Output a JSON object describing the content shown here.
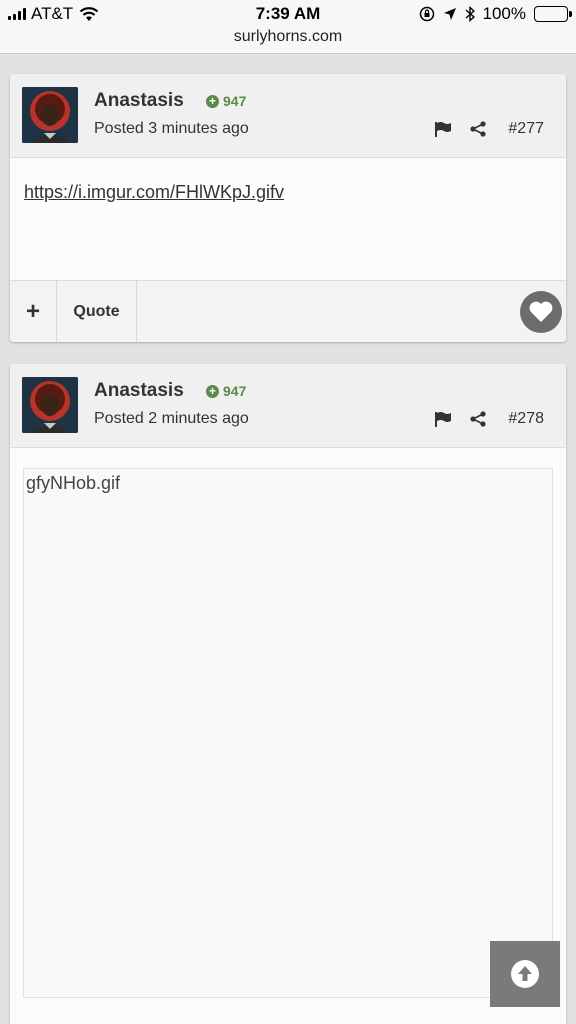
{
  "status_bar": {
    "carrier": "AT&T",
    "time": "7:39 AM",
    "battery": "100%",
    "url": "surlyhorns.com"
  },
  "posts": [
    {
      "author": "Anastasis",
      "reputation": "947",
      "posted": "Posted 3 minutes ago",
      "post_number": "#277",
      "content_link": "https://i.imgur.com/FHlWKpJ.gifv",
      "footer": {
        "plus_label": "+",
        "quote_label": "Quote"
      }
    },
    {
      "author": "Anastasis",
      "reputation": "947",
      "posted": "Posted 2 minutes ago",
      "post_number": "#278",
      "attachment_name": "gfyNHob.gif"
    }
  ],
  "icons": {
    "flag": "flag-icon",
    "share": "share-icon",
    "heart": "heart-icon",
    "scroll_top": "arrow-up-circle-icon"
  },
  "colors": {
    "reputation_green": "#5b8a4a",
    "page_background": "#e2e2e2",
    "button_grey": "#7a7a7a"
  }
}
